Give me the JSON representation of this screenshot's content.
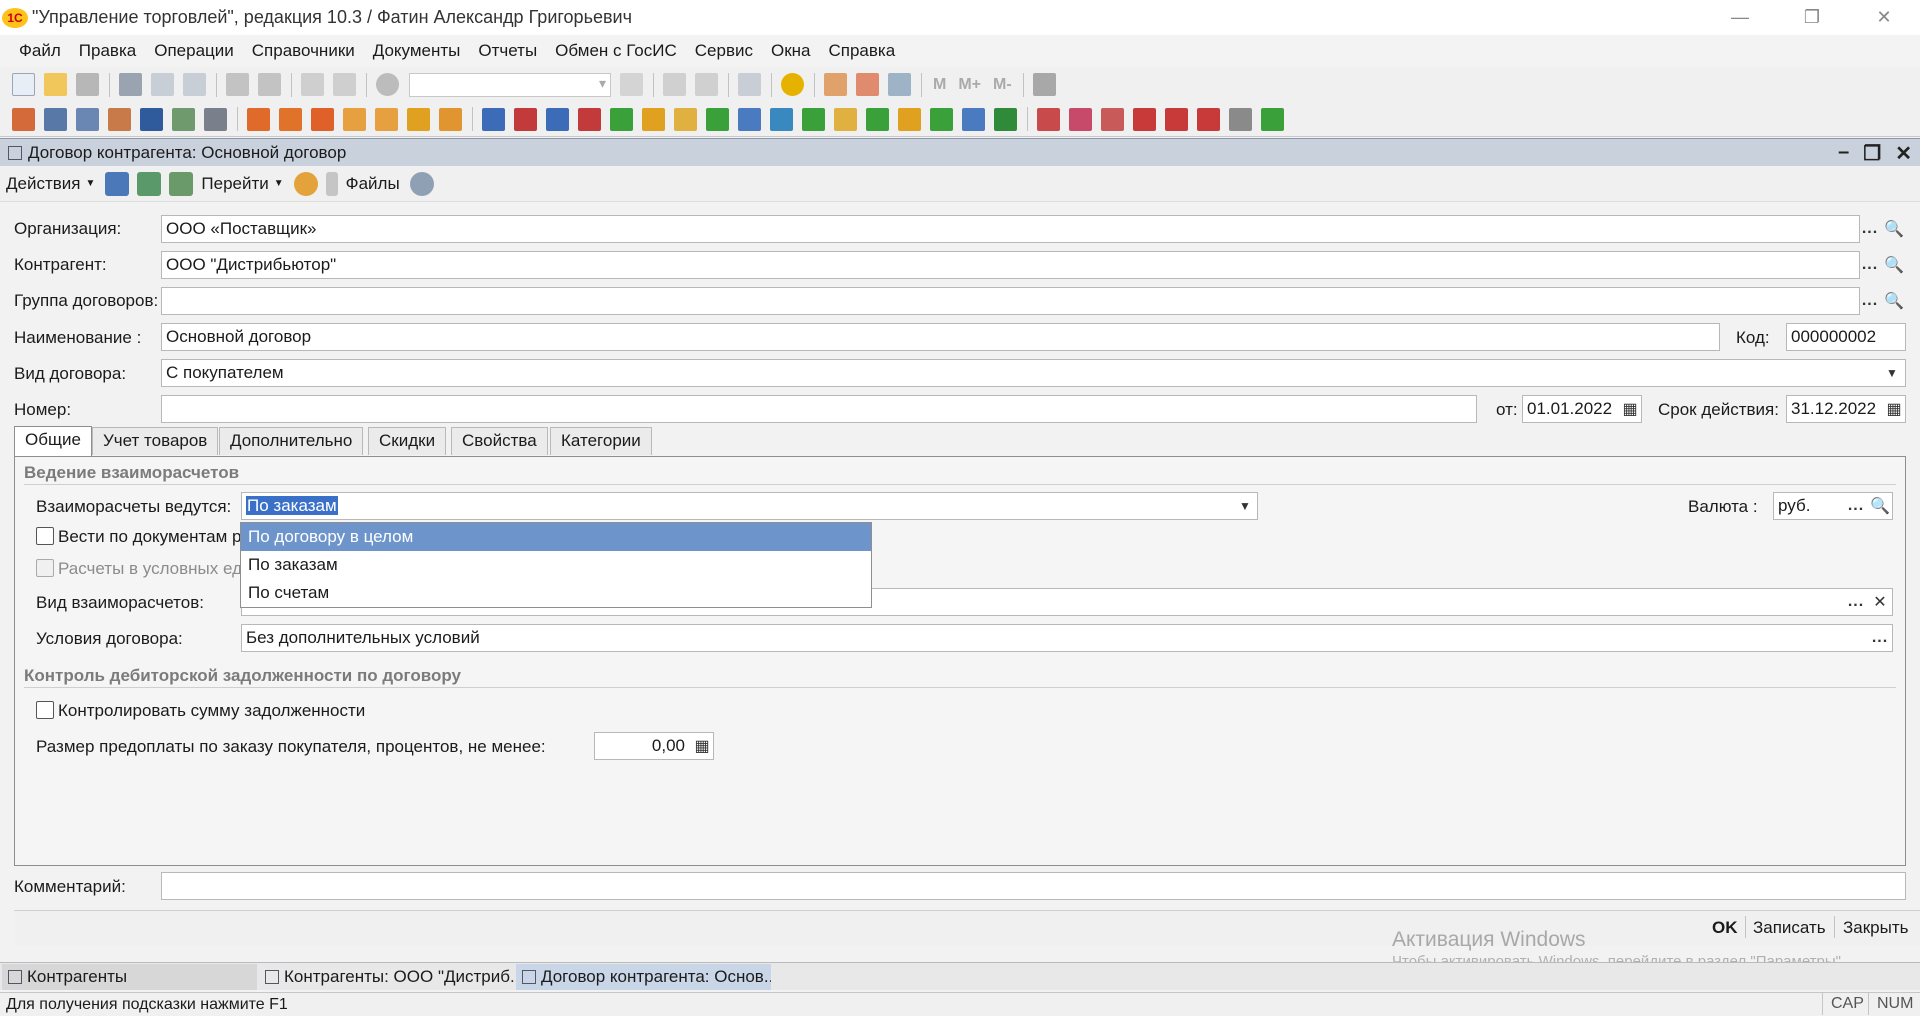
{
  "app": {
    "title": "\"Управление торговлей\", редакция 10.3 / Фатин Александр Григорьевич",
    "logo_text": "1С",
    "window_controls": {
      "minimize": "—",
      "restore": "❐",
      "close": "✕"
    }
  },
  "menu": [
    "Файл",
    "Правка",
    "Операции",
    "Справочники",
    "Документы",
    "Отчеты",
    "Обмен с ГосИС",
    "Сервис",
    "Окна",
    "Справка"
  ],
  "toolbar_text": {
    "m": "M",
    "mplus": "M+",
    "mminus": "M-"
  },
  "document": {
    "title": "Договор контрагента: Основной договор",
    "actions": {
      "actions_label": "Действия",
      "goto_label": "Перейти",
      "files_label": "Файлы"
    }
  },
  "form": {
    "organization": {
      "label": "Организация:",
      "value": "ООО «Поставщик»"
    },
    "counterparty": {
      "label": "Контрагент:",
      "value": "ООО \"Дистрибьютор\""
    },
    "contract_group": {
      "label": "Группа договоров:",
      "value": ""
    },
    "name": {
      "label": "Наименование :",
      "value": "Основной договор"
    },
    "code": {
      "label": "Код:",
      "value": "000000002"
    },
    "contract_type": {
      "label": "Вид договора:",
      "value": "С покупателем"
    },
    "number": {
      "label": "Номер:",
      "value": ""
    },
    "date_from": {
      "label": "от:",
      "value": "01.01.2022"
    },
    "valid_until": {
      "label": "Срок действия:",
      "value": "31.12.2022"
    },
    "comment": {
      "label": "Комментарий:",
      "value": ""
    }
  },
  "tabs": [
    "Общие",
    "Учет товаров",
    "Дополнительно",
    "Скидки",
    "Свойства",
    "Категории"
  ],
  "general": {
    "settlements_group": "Ведение взаиморасчетов",
    "settlements_by": {
      "label": "Взаиморасчеты ведутся:",
      "value": "По заказам"
    },
    "currency": {
      "label": "Валюта :",
      "value": "руб."
    },
    "by_documents_label": "Вести по документам ра",
    "conventional_units_label": "Расчеты в условных еди",
    "settlement_type": {
      "label": "Вид взаиморасчетов:",
      "value": ""
    },
    "contract_terms": {
      "label": "Условия договора:",
      "value": "Без дополнительных условий"
    },
    "debt_group": "Контроль дебиторской задолженности по договору",
    "control_debt_label": "Контролировать сумму задолженности",
    "prepayment": {
      "label": "Размер предоплаты по заказу покупателя, процентов, не менее:",
      "value": "0,00"
    }
  },
  "dropdown": {
    "options": [
      "По договору в целом",
      "По заказам",
      "По счетам"
    ],
    "highlighted": "По договору в целом"
  },
  "buttons": {
    "ok": "OK",
    "save": "Записать",
    "close": "Закрыть"
  },
  "watermark": {
    "line1": "Активация Windows",
    "line2": "Чтобы активировать Windows, перейдите в раздел \"Параметры\"."
  },
  "taskbar": [
    "Контрагенты",
    "Контрагенты: ООО \"Дистриб...",
    "Договор контрагента: Основ..."
  ],
  "status": {
    "hint": "Для получения подсказки нажмите F1",
    "cap": "CAP",
    "num": "NUM"
  },
  "colors": {
    "accent_selection": "#6d95cc",
    "doc_title_bg": "#c9d1dd",
    "group_text": "#7b7b7b"
  }
}
